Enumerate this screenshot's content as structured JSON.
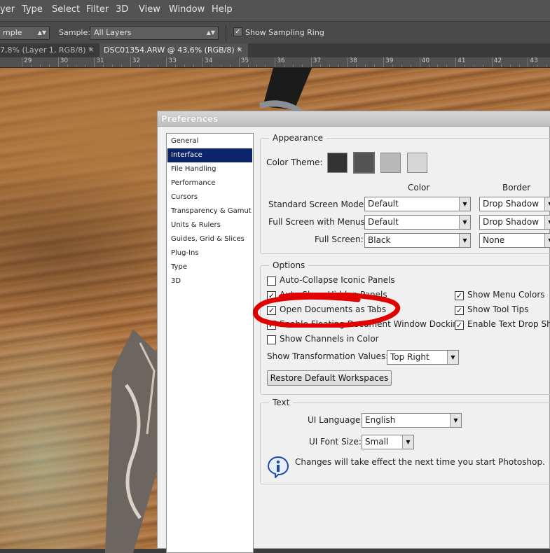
{
  "menu": [
    "yer",
    "Type",
    "Select",
    "Filter",
    "3D",
    "View",
    "Window",
    "Help"
  ],
  "options_bar": {
    "mode_value": "mple",
    "sample_label": "Sample:",
    "sample_value": "All Layers",
    "sampling_ring_label": "Show Sampling Ring",
    "sampling_ring_checked": true
  },
  "doc_tabs": [
    {
      "label": "7,8% (Layer 1, RGB/8) *",
      "close": "×"
    },
    {
      "label": "DSC01354.ARW @ 43,6% (RGB/8) *",
      "close": "×"
    }
  ],
  "ruler_labels": [
    "29",
    "30",
    "31",
    "32",
    "33",
    "34",
    "35",
    "36",
    "37",
    "38",
    "39",
    "40",
    "41",
    "42",
    "43"
  ],
  "dialog": {
    "title": "Preferences",
    "nav": [
      "General",
      "Interface",
      "File Handling",
      "Performance",
      "Cursors",
      "Transparency & Gamut",
      "Units & Rulers",
      "Guides, Grid & Slices",
      "Plug-Ins",
      "Type",
      "3D"
    ],
    "nav_selected": "Interface",
    "appearance": {
      "legend": "Appearance",
      "color_theme_label": "Color Theme:",
      "theme_colors": [
        "#333333",
        "#535353",
        "#b8b8b8",
        "#d6d6d6"
      ],
      "color_col": "Color",
      "border_col": "Border",
      "rows": [
        {
          "label": "Standard Screen Mode:",
          "color": "Default",
          "border": "Drop Shadow"
        },
        {
          "label": "Full Screen with Menus:",
          "color": "Default",
          "border": "Drop Shadow"
        },
        {
          "label": "Full Screen:",
          "color": "Black",
          "border": "None"
        }
      ]
    },
    "options": {
      "legend": "Options",
      "auto_collapse": "Auto-Collapse Iconic Panels",
      "auto_show": "Auto-Show Hidden Panels",
      "open_docs_tabs": "Open Documents as Tabs",
      "floating_dock": "Enable Floating Document Window Docking",
      "channels_color": "Show Channels in Color",
      "show_menu_colors": "Show Menu Colors",
      "show_tool_tips": "Show Tool Tips",
      "text_drop_shadow": "Enable Text Drop Sha",
      "transform_label": "Show Transformation Values:",
      "transform_value": "Top Right",
      "restore_button": "Restore Default Workspaces"
    },
    "text": {
      "legend": "Text",
      "ui_language_label": "UI Language:",
      "ui_language_value": "English",
      "ui_font_size_label": "UI Font Size:",
      "ui_font_size_value": "Small",
      "info_message": "Changes will take effect the next time you start Photoshop."
    }
  },
  "annotation": {
    "color": "#e00000"
  }
}
